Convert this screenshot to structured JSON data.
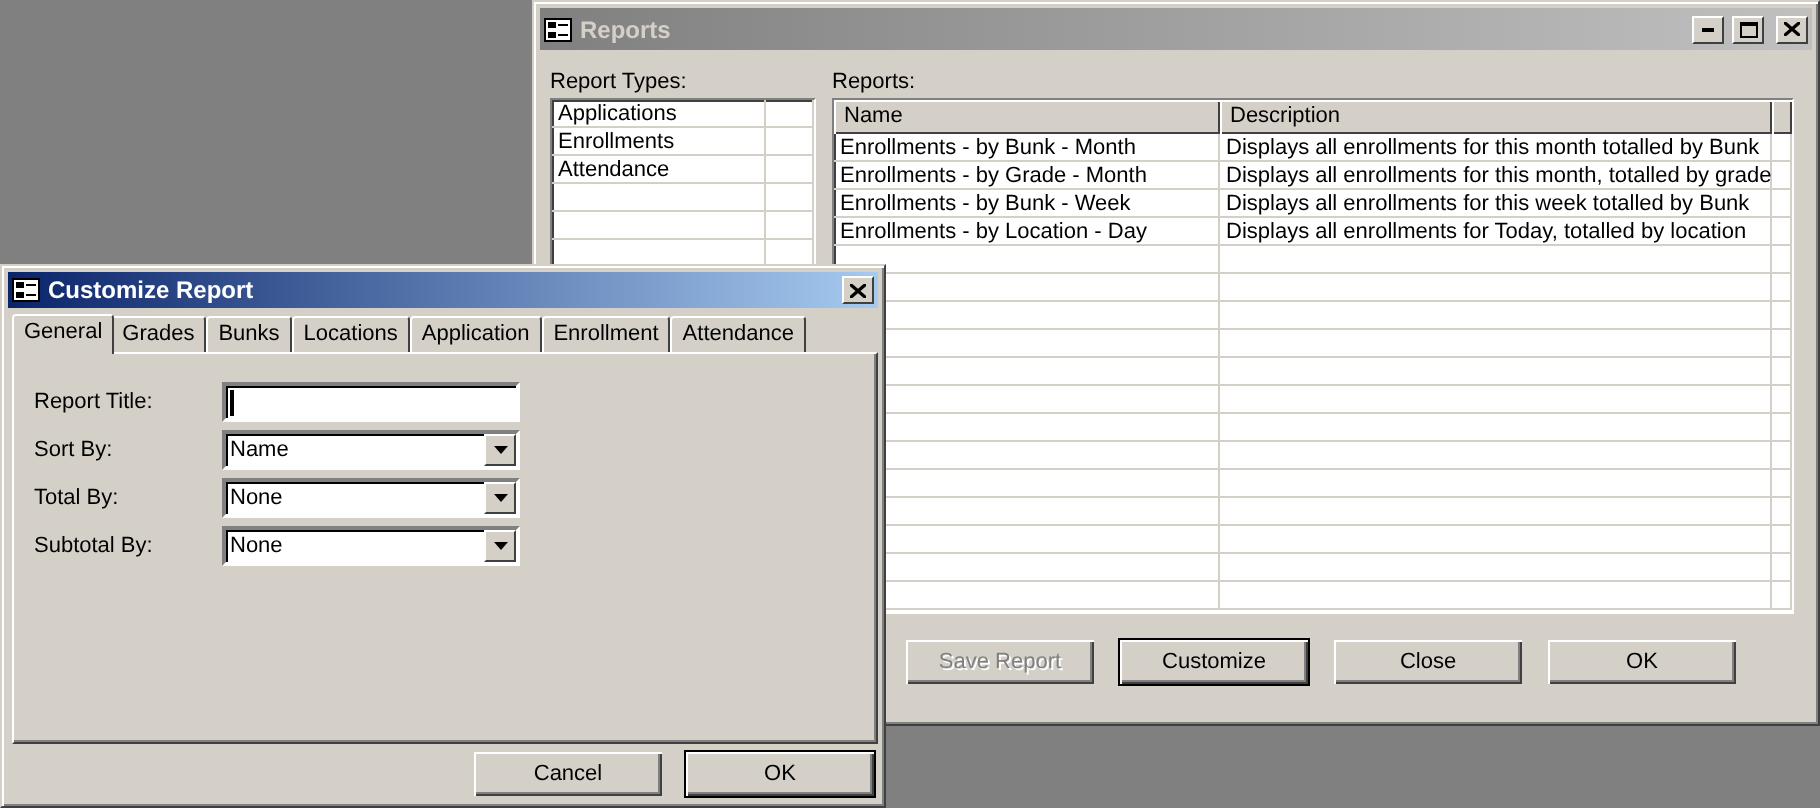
{
  "reports_window": {
    "title": "Reports",
    "active": false,
    "report_types": {
      "label": "Report Types:",
      "items": [
        {
          "label": "Applications",
          "selected": false
        },
        {
          "label": "Enrollments",
          "selected": false
        },
        {
          "label": "Attendance",
          "selected": false
        }
      ]
    },
    "reports": {
      "label": "Reports:",
      "columns": [
        "Name",
        "Description"
      ],
      "rows": [
        {
          "name": "Enrollments - by Bunk - Month",
          "description": "Displays all enrollments for this month totalled by Bunk"
        },
        {
          "name": "Enrollments - by Grade - Month",
          "description": "Displays all enrollments for this month, totalled by grade"
        },
        {
          "name": "Enrollments - by Bunk - Week",
          "description": "Displays all enrollments for this week totalled by Bunk"
        },
        {
          "name": "Enrollments - by Location - Day",
          "description": "Displays all enrollments for Today, totalled by location"
        }
      ]
    },
    "buttons": [
      {
        "label": "Save Report",
        "disabled": true,
        "default": false
      },
      {
        "label": "Customize",
        "disabled": false,
        "default": true
      },
      {
        "label": "Close",
        "disabled": false,
        "default": false
      },
      {
        "label": "OK",
        "disabled": false,
        "default": false
      }
    ]
  },
  "customize_dialog": {
    "title": "Customize Report",
    "active": true,
    "tabs": [
      {
        "label": "General",
        "selected": true
      },
      {
        "label": "Grades",
        "selected": false
      },
      {
        "label": "Bunks",
        "selected": false
      },
      {
        "label": "Locations",
        "selected": false
      },
      {
        "label": "Application",
        "selected": false
      },
      {
        "label": "Enrollment",
        "selected": false
      },
      {
        "label": "Attendance",
        "selected": false
      }
    ],
    "fields": [
      {
        "kind": "text",
        "label": "Report Title:",
        "focused": true
      },
      {
        "kind": "dropdown",
        "label": "Sort By:",
        "value": "Name"
      },
      {
        "kind": "dropdown",
        "label": "Total By:",
        "value": "None"
      },
      {
        "kind": "dropdown",
        "label": "Subtotal By:",
        "value": "None"
      }
    ],
    "buttons": [
      {
        "label": "Cancel",
        "disabled": false,
        "default": false
      },
      {
        "label": "OK",
        "disabled": false,
        "default": true
      }
    ]
  }
}
